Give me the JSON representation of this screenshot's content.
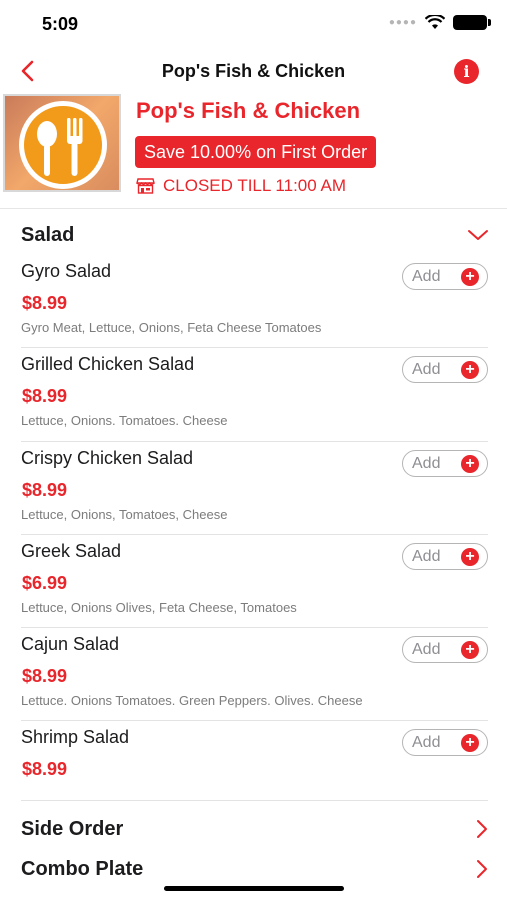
{
  "status_bar": {
    "time": "5:09",
    "signal_icon": "signal-dots-icon",
    "wifi_icon": "wifi-icon",
    "battery_icon": "battery-icon"
  },
  "nav": {
    "title": "Pop's Fish & Chicken",
    "back_icon": "chevron-left-icon",
    "info_icon": "info-icon",
    "info_glyph": "i"
  },
  "restaurant": {
    "name": "Pop's Fish & Chicken",
    "promo": "Save 10.00% on First Order",
    "status": "CLOSED TILL 11:00 AM",
    "status_icon": "store-icon",
    "logo_icon": "spoon-fork-icon"
  },
  "menu": {
    "category": "Salad",
    "category_icon": "chevron-down-icon",
    "add_label": "Add",
    "add_icon": "+",
    "items": [
      {
        "name": "Gyro Salad",
        "price": "$8.99",
        "description": "Gyro Meat, Lettuce, Onions, Feta Cheese Tomatoes"
      },
      {
        "name": "Grilled Chicken Salad",
        "price": "$8.99",
        "description": "Lettuce, Onions. Tomatoes. Cheese"
      },
      {
        "name": "Crispy Chicken Salad",
        "price": "$8.99",
        "description": "Lettuce, Onions, Tomatoes, Cheese"
      },
      {
        "name": "Greek Salad",
        "price": "$6.99",
        "description": "Lettuce, Onions Olives, Feta Cheese, Tomatoes"
      },
      {
        "name": "Cajun Salad",
        "price": "$8.99",
        "description": "Lettuce. Onions Tomatoes. Green Peppers. Olives. Cheese"
      },
      {
        "name": "Shrimp Salad",
        "price": "$8.99",
        "description": ""
      }
    ]
  },
  "other_categories": [
    {
      "name": "Side Order",
      "icon": "chevron-right-icon"
    },
    {
      "name": "Combo Plate",
      "icon": "chevron-right-icon"
    }
  ],
  "colors": {
    "accent": "#e8262b",
    "text": "#1c1c1e",
    "muted": "#7c7c7c",
    "divider": "#e3e3e3"
  }
}
